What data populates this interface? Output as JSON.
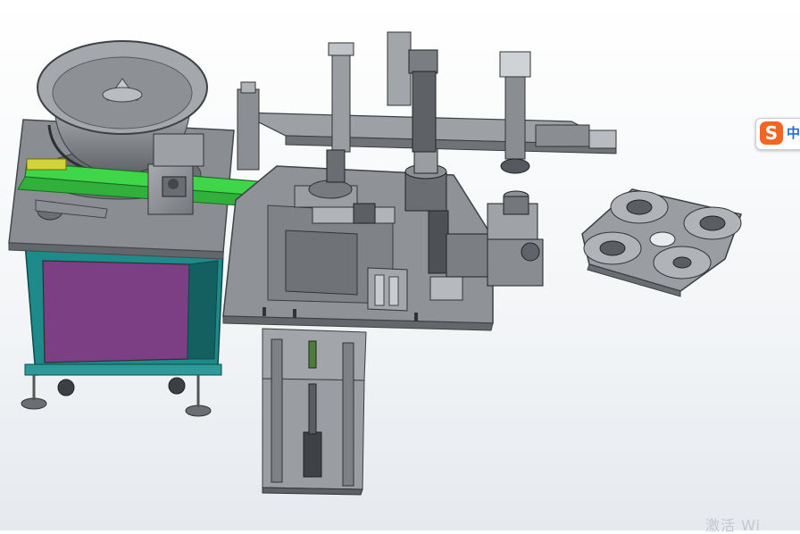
{
  "ime": {
    "logo_letter": "S",
    "mode_label": "中"
  },
  "watermark": {
    "text": "激活 Wi"
  },
  "colors": {
    "background": "#f4f6f8",
    "metal": "#8f9398",
    "metal_dark": "#5f6368",
    "cabinet_frame": "#1f8a8a",
    "cabinet_panel": "#7c3f84",
    "conveyor": "#3fd64a",
    "ime_logo": "#f26522"
  }
}
